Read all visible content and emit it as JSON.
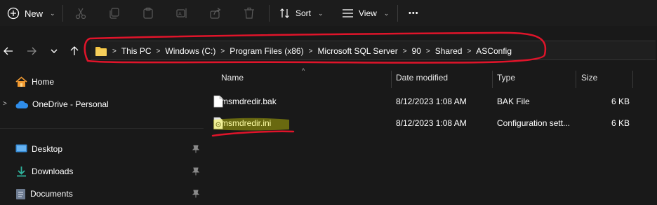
{
  "toolbar": {
    "new_label": "New",
    "sort_label": "Sort",
    "view_label": "View",
    "more_label": "•••",
    "icons": [
      "cut-icon",
      "copy-icon",
      "paste-icon",
      "rename-icon",
      "share-icon",
      "delete-icon"
    ]
  },
  "nav": {
    "back_icon": "arrow-left-icon",
    "forward_icon": "arrow-right-icon",
    "recent_icon": "chevron-down-icon",
    "up_icon": "arrow-up-icon"
  },
  "breadcrumb": [
    "This PC",
    "Windows (C:)",
    "Program Files (x86)",
    "Microsoft SQL Server",
    "90",
    "Shared",
    "ASConfig"
  ],
  "sidebar": {
    "items": [
      {
        "label": "Home",
        "icon": "home-icon"
      },
      {
        "label": "OneDrive - Personal",
        "icon": "cloud-icon"
      },
      {
        "label": "Desktop",
        "icon": "desktop-icon"
      },
      {
        "label": "Downloads",
        "icon": "download-icon"
      },
      {
        "label": "Documents",
        "icon": "documents-icon"
      }
    ]
  },
  "columns": {
    "name": "Name",
    "date": "Date modified",
    "type": "Type",
    "size": "Size"
  },
  "files": [
    {
      "name": "msmdredir.bak",
      "date": "8/12/2023 1:08 AM",
      "type": "BAK File",
      "size": "6 KB"
    },
    {
      "name": "msmdredir.ini",
      "date": "8/12/2023 1:08 AM",
      "type": "Configuration sett...",
      "size": "6 KB"
    }
  ],
  "colors": {
    "background": "#191919",
    "toolbar": "#1c1c1c",
    "annotation_red": "#e0142a",
    "highlight_yellow": "#ffff00",
    "folder_yellow": "#f4c542",
    "onedrive_blue": "#2f8dea"
  }
}
